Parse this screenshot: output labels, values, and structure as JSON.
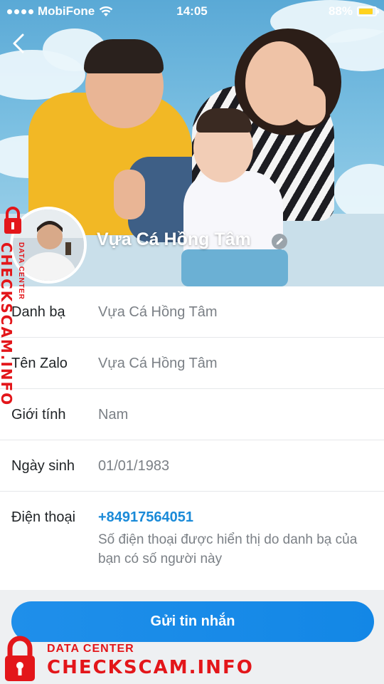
{
  "status_bar": {
    "carrier": "MobiFone",
    "time": "14:05",
    "battery_percent": "88%",
    "battery_level": 0.88,
    "battery_color": "#ffd21f"
  },
  "profile": {
    "name": "Vựa Cá Hồng Tâm"
  },
  "info_rows": [
    {
      "label": "Danh bạ",
      "value": "Vựa Cá Hồng Tâm"
    },
    {
      "label": "Tên Zalo",
      "value": "Vựa Cá Hồng Tâm"
    },
    {
      "label": "Giới tính",
      "value": "Nam"
    },
    {
      "label": "Ngày sinh",
      "value": "01/01/1983"
    },
    {
      "label": "Điện thoại",
      "value": "+84917564051",
      "note": "Số điện thoại được hiển thị do danh bạ của bạn có số người này"
    }
  ],
  "actions": {
    "send_message_label": "Gửi tin nhắn"
  },
  "watermark": {
    "top_line": "DATA CENTER",
    "brand": "CHECKSCAM.INFO",
    "color": "#e3161a"
  },
  "colors": {
    "accent": "#1a8ad8",
    "button": "#1f8fea"
  }
}
